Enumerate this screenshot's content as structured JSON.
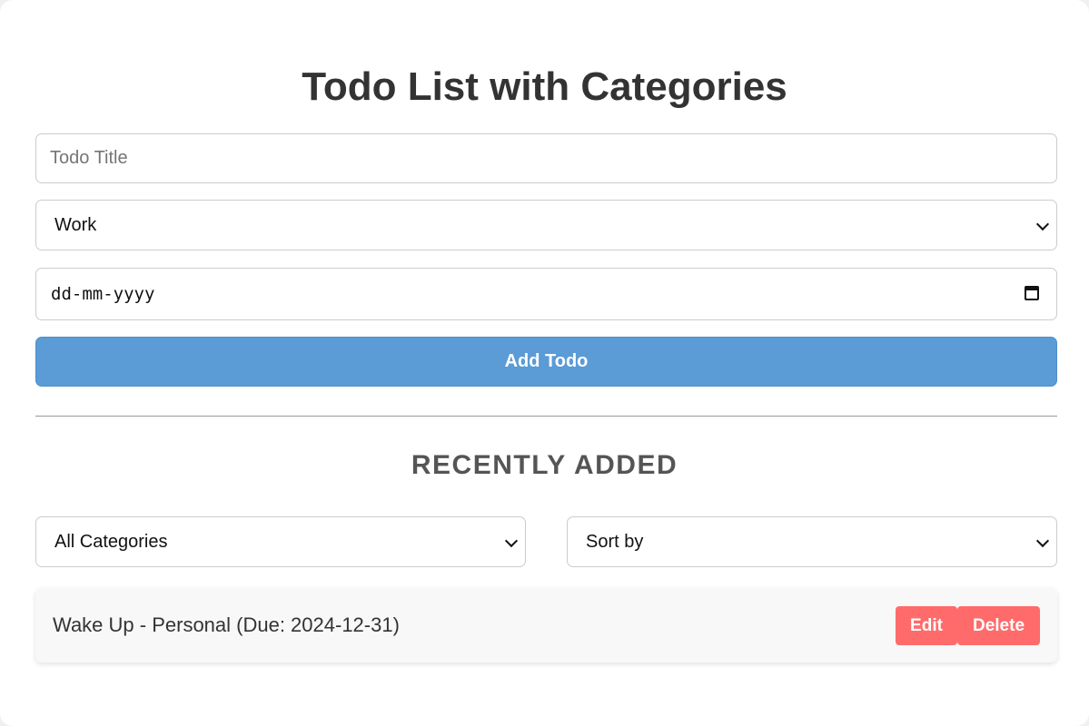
{
  "header": {
    "title": "Todo List with Categories"
  },
  "form": {
    "title_placeholder": "Todo Title",
    "title_value": "",
    "category_selected": "Work",
    "date_placeholder": "dd-mm-yyyy",
    "add_label": "Add Todo"
  },
  "list_section": {
    "heading": "RECENTLY ADDED",
    "filter_selected": "All Categories",
    "sort_selected": "Sort by"
  },
  "todos": [
    {
      "text": "Wake Up - Personal (Due: 2024-12-31)",
      "edit_label": "Edit",
      "delete_label": "Delete"
    }
  ],
  "colors": {
    "primary_button": "#5b9bd6",
    "danger_button": "#ff6b6b",
    "title_text": "#333333"
  },
  "icons": {
    "dropdown": "chevron-down-icon",
    "date": "calendar-icon"
  }
}
